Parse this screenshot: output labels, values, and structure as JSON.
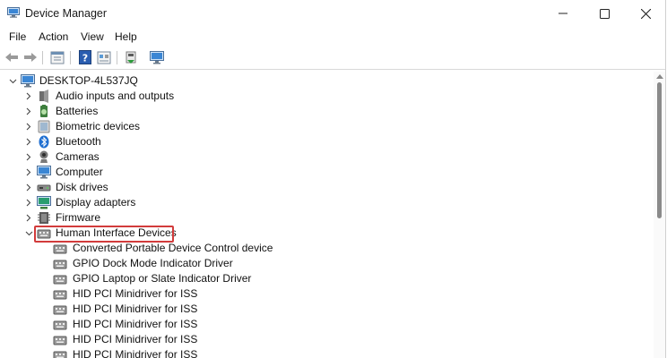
{
  "window": {
    "title": "Device Manager",
    "icon": "device-manager-icon"
  },
  "caption": {
    "minimize_icon": "minimize-icon",
    "maximize_icon": "maximize-icon",
    "close_icon": "close-icon"
  },
  "menu": {
    "items": [
      "File",
      "Action",
      "View",
      "Help"
    ]
  },
  "toolbar": {
    "icons": [
      "back-arrow-icon",
      "forward-arrow-icon",
      "properties-sheet-icon",
      "help-icon",
      "show-hidden-icon",
      "update-driver-icon",
      "monitor-icon"
    ]
  },
  "tree": {
    "root": {
      "label": "DESKTOP-4L537JQ",
      "icon": "computer-icon"
    },
    "categories": [
      {
        "label": "Audio inputs and outputs",
        "icon": "speaker-icon"
      },
      {
        "label": "Batteries",
        "icon": "battery-icon"
      },
      {
        "label": "Biometric devices",
        "icon": "biometric-icon"
      },
      {
        "label": "Bluetooth",
        "icon": "bluetooth-icon"
      },
      {
        "label": "Cameras",
        "icon": "camera-icon"
      },
      {
        "label": "Computer",
        "icon": "monitor-icon"
      },
      {
        "label": "Disk drives",
        "icon": "disk-drive-icon"
      },
      {
        "label": "Display adapters",
        "icon": "display-adapter-icon"
      },
      {
        "label": "Firmware",
        "icon": "firmware-icon"
      },
      {
        "label": "Human Interface Devices",
        "icon": "hid-icon",
        "expanded": true,
        "highlight_color": "#d23b3b"
      }
    ],
    "hid_children": [
      "Converted Portable Device Control device",
      "GPIO Dock Mode Indicator Driver",
      "GPIO Laptop or Slate Indicator Driver",
      "HID PCI Minidriver for ISS",
      "HID PCI Minidriver for ISS",
      "HID PCI Minidriver for ISS",
      "HID PCI Minidriver for ISS",
      "HID PCI Minidriver for ISS"
    ]
  },
  "colors": {
    "highlight_border": "#d23b3b",
    "accent_blue": "#2f7ad6"
  }
}
